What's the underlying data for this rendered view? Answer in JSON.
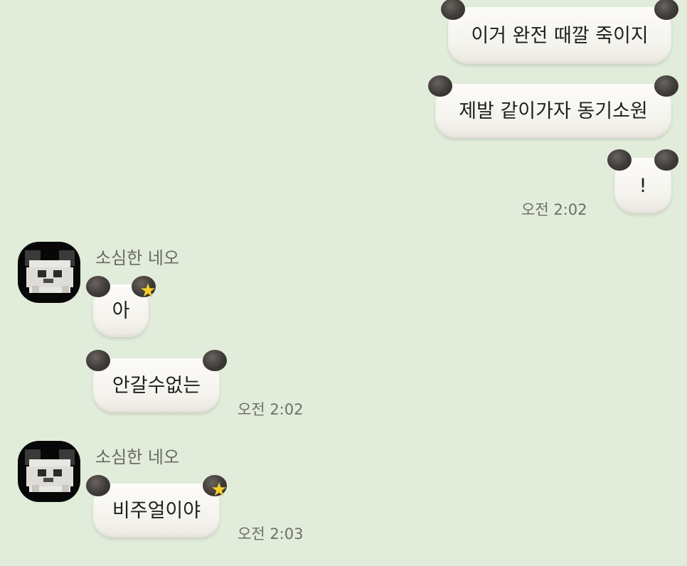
{
  "colors": {
    "background": "#e1ecda",
    "bubble": "#f8f7f3",
    "panda_ear": "#3e3a37",
    "star": "#f5cf2d",
    "timestamp": "#6e6f68"
  },
  "outgoing": {
    "messages": [
      {
        "text": "이거 완전 때깔 죽이지"
      },
      {
        "text": "제발 같이가자 동기소원"
      },
      {
        "text": "!"
      }
    ],
    "time": "오전 2:02"
  },
  "incoming": [
    {
      "sender": "소심한 네오",
      "avatar_icon": "pixel-panda-avatar-icon",
      "messages": [
        {
          "text": "아"
        },
        {
          "text": "안갈수없는"
        }
      ],
      "time": "오전 2:02"
    },
    {
      "sender": "소심한 네오",
      "avatar_icon": "pixel-panda-avatar-icon",
      "messages": [
        {
          "text": "비주얼이야"
        }
      ],
      "time": "오전 2:03"
    }
  ]
}
